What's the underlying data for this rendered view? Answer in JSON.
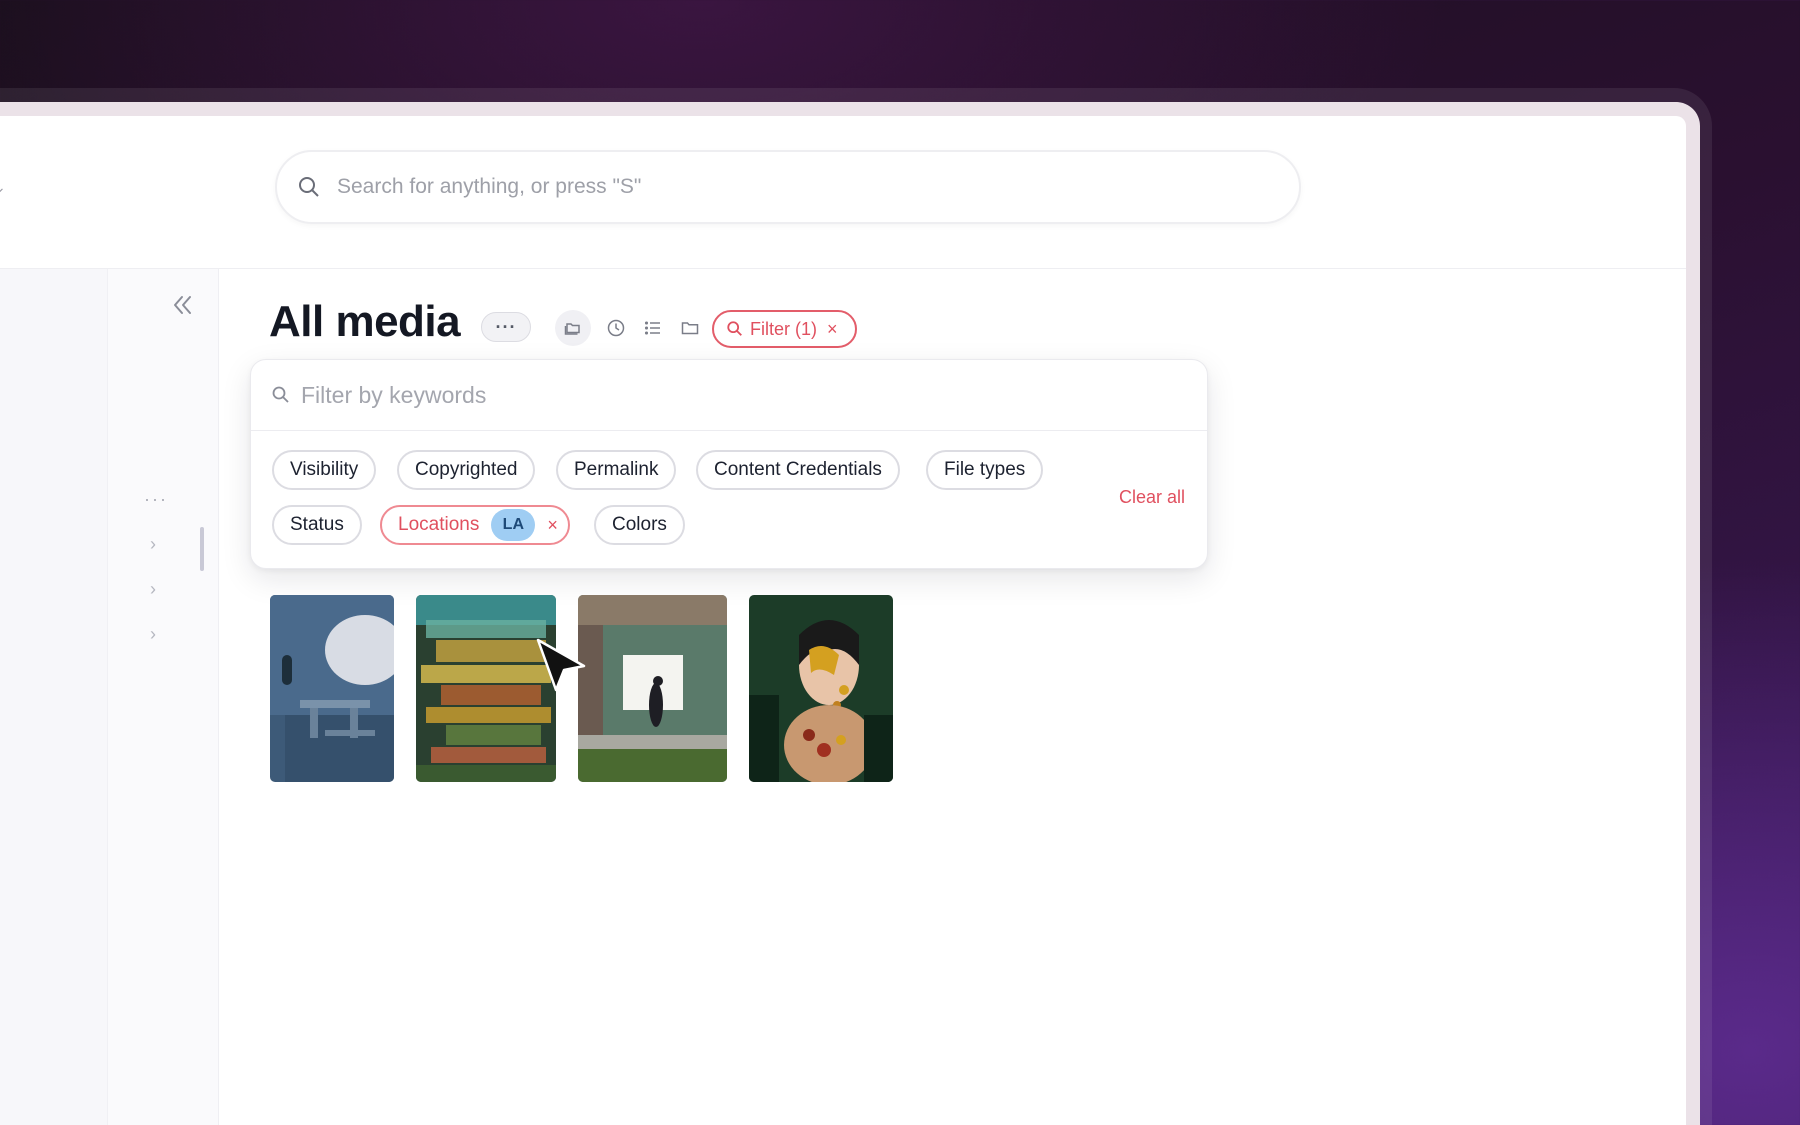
{
  "search": {
    "placeholder": "Search for anything, or press \"S\""
  },
  "page": {
    "title": "All media",
    "more_label": "···"
  },
  "filter_button": {
    "label": "Filter (1)",
    "close": "×"
  },
  "filter_panel": {
    "search_placeholder": "Filter by keywords",
    "pills_row1": [
      "Visibility",
      "Copyrighted",
      "Permalink",
      "Content Credentials",
      "File types"
    ],
    "pills_row2": {
      "status": "Status",
      "locations": "Locations",
      "locations_badge": "LA",
      "locations_remove": "×",
      "colors": "Colors"
    },
    "clear_all": "Clear all"
  },
  "sidebar": {
    "dots": "···",
    "chevrons": [
      "›",
      "›",
      "›"
    ]
  },
  "colors": {
    "accent": "#e0505f",
    "badge_bg": "#9fcdf3",
    "title": "#141823"
  },
  "icons": [
    "search-icon",
    "collapse-sidebar-icon",
    "folders-icon",
    "clock-icon",
    "list-icon",
    "folder-icon",
    "cursor-icon"
  ],
  "thumbnails": [
    {
      "name": "blue-room-table",
      "color": "#3d5a78"
    },
    {
      "name": "motion-blur-colors",
      "color": "#5a6a30"
    },
    {
      "name": "street-billboard-walker",
      "color": "#4e6a5c"
    },
    {
      "name": "gold-mask-portrait",
      "color": "#1c3c28"
    }
  ]
}
